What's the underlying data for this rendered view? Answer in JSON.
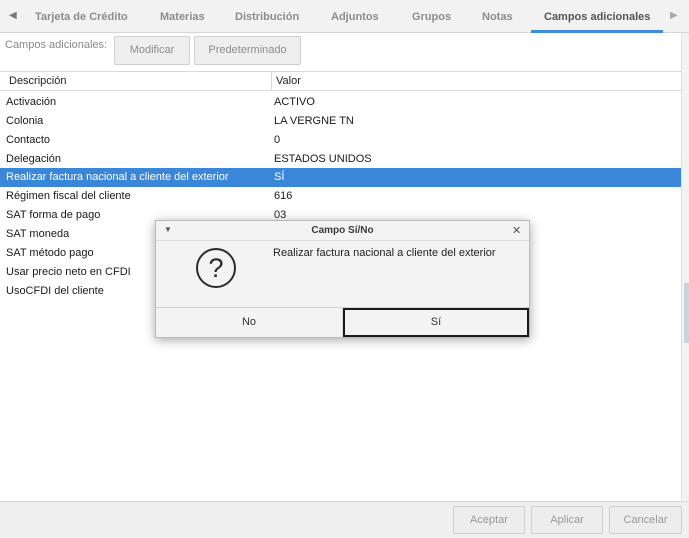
{
  "tabs": {
    "items": [
      {
        "label": "Tarjeta de Crédito"
      },
      {
        "label": "Materias"
      },
      {
        "label": "Distribución"
      },
      {
        "label": "Adjuntos"
      },
      {
        "label": "Grupos"
      },
      {
        "label": "Notas"
      },
      {
        "label": "Campos adicionales"
      }
    ],
    "active": "Campos adicionales"
  },
  "toolbar": {
    "label": "Campos adicionales:",
    "modify_label": "Modificar",
    "default_label": "Predeterminado"
  },
  "table": {
    "columns": [
      "Descripción",
      "Valor"
    ],
    "rows": [
      {
        "desc": "Activación",
        "value": "ACTIVO"
      },
      {
        "desc": "Colonia",
        "value": "LA VERGNE  TN"
      },
      {
        "desc": "Contacto",
        "value": "0"
      },
      {
        "desc": "Delegación",
        "value": "ESTADOS UNIDOS"
      },
      {
        "desc": "Realizar factura nacional a cliente del exterior",
        "value": "SÍ"
      },
      {
        "desc": "Régimen fiscal del cliente",
        "value": "616"
      },
      {
        "desc": "SAT forma de pago",
        "value": "03"
      },
      {
        "desc": "SAT moneda",
        "value": ""
      },
      {
        "desc": "SAT método pago",
        "value": ""
      },
      {
        "desc": "Usar precio neto en CFDI",
        "value": ""
      },
      {
        "desc": "UsoCFDI del cliente",
        "value": ""
      }
    ],
    "selected_row": 4
  },
  "dialog": {
    "title": "Campo Sí/No",
    "message": "Realizar factura nacional a cliente del exterior",
    "no_label": "No",
    "yes_label": "Sí",
    "icon": "question-icon"
  },
  "footer": {
    "accept_label": "Aceptar",
    "apply_label": "Aplicar",
    "cancel_label": "Cancelar"
  },
  "colors": {
    "accent": "#3a86d9",
    "tab_underline": "#3b8ee0"
  }
}
